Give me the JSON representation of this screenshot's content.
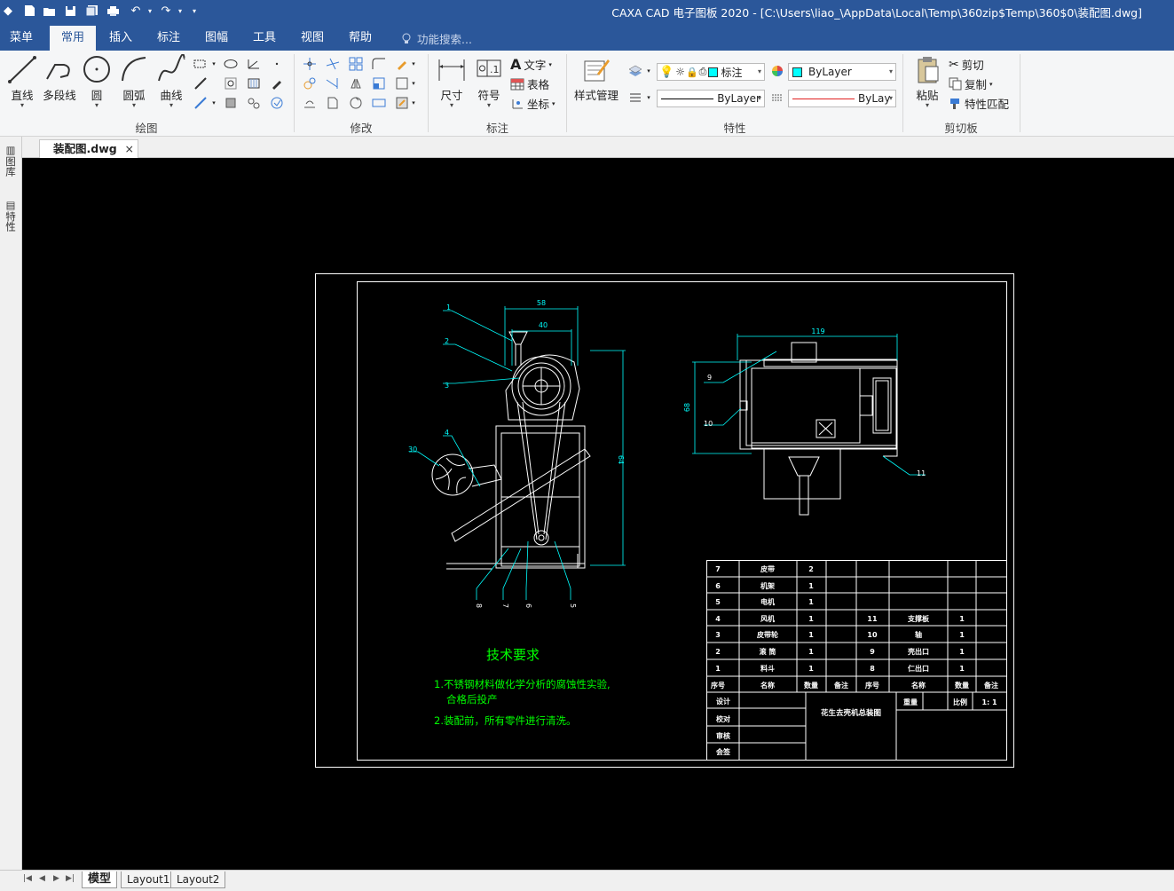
{
  "window": {
    "title": "CAXA CAD 电子图板 2020 - [C:\\Users\\liao_\\AppData\\Local\\Temp\\360zip$Temp\\360$0\\装配图.dwg]"
  },
  "menu": {
    "tabs": [
      {
        "label": "菜单"
      },
      {
        "label": "常用"
      },
      {
        "label": "插入"
      },
      {
        "label": "标注"
      },
      {
        "label": "图幅"
      },
      {
        "label": "工具"
      },
      {
        "label": "视图"
      },
      {
        "label": "帮助"
      }
    ],
    "active_tab": "常用",
    "search_placeholder": "功能搜索..."
  },
  "ribbon": {
    "draw": {
      "group_label": "绘图",
      "line": "直线",
      "polyline": "多段线",
      "circle": "圆",
      "arc": "圆弧",
      "curve": "曲线"
    },
    "modify": {
      "group_label": "修改"
    },
    "annotate": {
      "group_label": "标注",
      "dimension": "尺寸",
      "symbol": "符号",
      "text": "文字",
      "table": "表格",
      "coordinate": "坐标"
    },
    "properties": {
      "group_label": "特性",
      "style_manager": "样式管理",
      "layer_combo": "标注",
      "color_combo": "ByLayer",
      "linetype_combo": "ByLayer",
      "lineweight_combo": "ByLay"
    },
    "clipboard": {
      "group_label": "剪切板",
      "paste": "粘贴",
      "cut": "剪切",
      "copy": "复制",
      "match": "特性匹配"
    }
  },
  "colors": {
    "accent": "#2b579a",
    "canvas": "#000000",
    "cyan": "#00ffff",
    "green_text": "#00ff00"
  },
  "document": {
    "tab_label": "装配图.dwg",
    "close_glyph": "×"
  },
  "side_panel": {
    "library": "图库",
    "properties": "特性"
  },
  "layout_tabs": {
    "items": [
      "模型",
      "Layout1",
      "Layout2"
    ],
    "active": "模型"
  },
  "drawing": {
    "dimensions": {
      "d58": "58",
      "d40": "40",
      "d64": "64",
      "d119": "119",
      "d68": "68"
    },
    "balloons": {
      "b1": "1",
      "b2": "2",
      "b3": "3",
      "b4": "4",
      "b30": "30",
      "b5": "5",
      "b6": "6",
      "b7": "7",
      "b8": "8",
      "b9": "9",
      "b10": "10",
      "b11": "11"
    },
    "tech_title": "技术要求",
    "tech_notes": [
      "1.不锈钢材料做化学分析的腐蚀性实验,",
      "合格后投产",
      "2.装配前，所有零件进行清洗。"
    ],
    "bom": {
      "rows": [
        {
          "no": "7",
          "name": "皮带",
          "qty": "2",
          "note": "",
          "no2": "",
          "name2": "",
          "qty2": "",
          "note2": ""
        },
        {
          "no": "6",
          "name": "机架",
          "qty": "1",
          "note": "",
          "no2": "",
          "name2": "",
          "qty2": "",
          "note2": ""
        },
        {
          "no": "5",
          "name": "电机",
          "qty": "1",
          "note": "",
          "no2": "",
          "name2": "",
          "qty2": "",
          "note2": ""
        },
        {
          "no": "4",
          "name": "风机",
          "qty": "1",
          "note": "",
          "no2": "11",
          "name2": "支撑板",
          "qty2": "1",
          "note2": ""
        },
        {
          "no": "3",
          "name": "皮带轮",
          "qty": "1",
          "note": "",
          "no2": "10",
          "name2": "轴",
          "qty2": "1",
          "note2": ""
        },
        {
          "no": "2",
          "name": "滚 筒",
          "qty": "1",
          "note": "",
          "no2": "9",
          "name2": "壳出口",
          "qty2": "1",
          "note2": ""
        },
        {
          "no": "1",
          "name": "料斗",
          "qty": "1",
          "note": "",
          "no2": "8",
          "name2": "仁出口",
          "qty2": "1",
          "note2": ""
        }
      ],
      "header": [
        "序号",
        "名称",
        "数量",
        "备注",
        "序号",
        "名称",
        "数量",
        "备注"
      ]
    },
    "title_block": {
      "design": "设计",
      "check": "校对",
      "review": "审核",
      "approve": "会签",
      "drawing_name": "花生去壳机总装图",
      "weight_label": "重量",
      "scale_label": "比例",
      "scale_value": "1: 1"
    }
  }
}
